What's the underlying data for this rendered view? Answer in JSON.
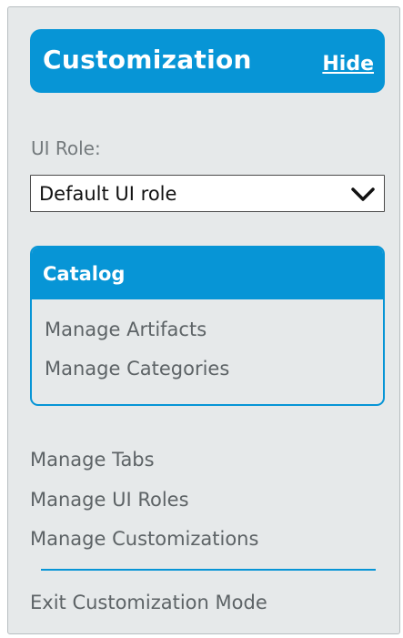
{
  "header": {
    "title": "Customization",
    "hide_label": "Hide"
  },
  "ui_role": {
    "label": "UI Role:",
    "selected": "Default UI role"
  },
  "catalog": {
    "title": "Catalog",
    "links": [
      "Manage Artifacts",
      "Manage Categories"
    ]
  },
  "menu": {
    "links": [
      "Manage Tabs",
      "Manage UI Roles",
      "Manage Customizations"
    ],
    "exit_label": "Exit Customization Mode"
  },
  "icons": {
    "select_arrow": "chevron-down-icon"
  },
  "colors": {
    "accent": "#0795d6",
    "panel_background": "#e6e9ea",
    "link_text": "#5d6366"
  }
}
